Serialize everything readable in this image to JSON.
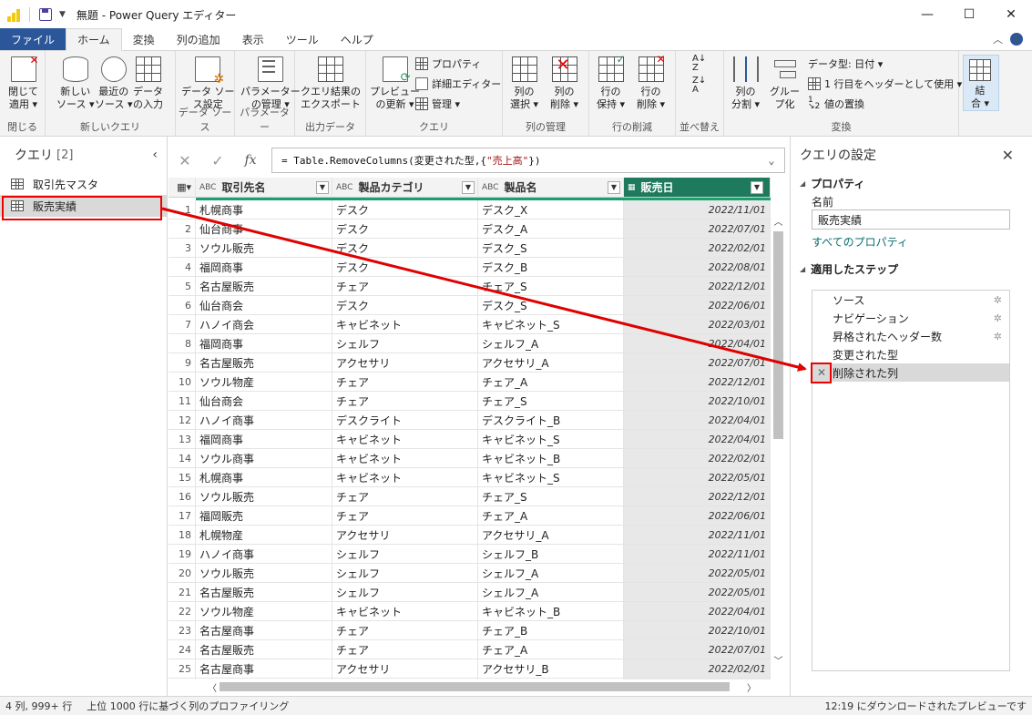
{
  "window": {
    "title": "無題 - Power Query エディター",
    "minimize": "—",
    "maximize": "☐",
    "close": "✕"
  },
  "tabs": [
    {
      "label": "ファイル"
    },
    {
      "label": "ホーム"
    },
    {
      "label": "変換"
    },
    {
      "label": "列の追加"
    },
    {
      "label": "表示"
    },
    {
      "label": "ツール"
    },
    {
      "label": "ヘルプ"
    }
  ],
  "tabs_right": {
    "collapse": "︿",
    "help": "?"
  },
  "ribbon": {
    "close_apply": "閉じて\n適用 ▾",
    "group_close": "閉じる",
    "new_source": "新しい\nソース ▾",
    "recent_source": "最近の\nソース ▾",
    "enter_data": "データ\nの入力",
    "group_new_query": "新しいクエリ",
    "datasource_settings": "データ ソー\nス設定",
    "group_datasource": "データ ソース",
    "manage_params": "パラメーター\nの管理 ▾",
    "group_params": "パラメーター",
    "export_results": "クエリ結果の\nエクスポート",
    "group_output": "出力データ",
    "refresh_preview": "プレビュー\nの更新 ▾",
    "properties": "プロパティ",
    "advanced_editor": "詳細エディター",
    "manage": "管理 ▾",
    "group_query": "クエリ",
    "choose_columns": "列の\n選択 ▾",
    "remove_columns": "列の\n削除 ▾",
    "group_manage_columns": "列の管理",
    "keep_rows": "行の\n保持 ▾",
    "remove_rows": "行の\n削除 ▾",
    "group_reduce_rows": "行の削減",
    "group_sort": "並べ替え",
    "split_column": "列の\n分割 ▾",
    "group_by": "グルー\nプ化",
    "data_type": "データ型: 日付 ▾",
    "first_row_header": "1 行目をヘッダーとして使用 ▾",
    "replace_values": "値の置換",
    "group_transform": "変換",
    "combine": "結\n合 ▾"
  },
  "queries_pane": {
    "title": "クエリ",
    "count": "[2]",
    "collapse": "‹",
    "items": [
      {
        "label": "取引先マスタ"
      },
      {
        "label": "販売実績"
      }
    ]
  },
  "formula": {
    "cancel": "✕",
    "commit": "✓",
    "fx": "fx",
    "prefix": "= Table.RemoveColumns(変更された型,{",
    "string": "\"売上高\"",
    "suffix": "})",
    "expand": "⌄"
  },
  "grid": {
    "columns": [
      {
        "type": "ABC",
        "label": "取引先名"
      },
      {
        "type": "ABC",
        "label": "製品カテゴリ"
      },
      {
        "type": "ABC",
        "label": "製品名"
      },
      {
        "type": "▦",
        "label": "販売日"
      }
    ],
    "rows": [
      [
        "1",
        "札幌商事",
        "デスク",
        "デスク_X",
        "2022/11/01"
      ],
      [
        "2",
        "仙台商事",
        "デスク",
        "デスク_A",
        "2022/07/01"
      ],
      [
        "3",
        "ソウル販売",
        "デスク",
        "デスク_S",
        "2022/02/01"
      ],
      [
        "4",
        "福岡商事",
        "デスク",
        "デスク_B",
        "2022/08/01"
      ],
      [
        "5",
        "名古屋販売",
        "チェア",
        "チェア_S",
        "2022/12/01"
      ],
      [
        "6",
        "仙台商会",
        "デスク",
        "デスク_S",
        "2022/06/01"
      ],
      [
        "7",
        "ハノイ商会",
        "キャビネット",
        "キャビネット_S",
        "2022/03/01"
      ],
      [
        "8",
        "福岡商事",
        "シェルフ",
        "シェルフ_A",
        "2022/04/01"
      ],
      [
        "9",
        "名古屋販売",
        "アクセサリ",
        "アクセサリ_A",
        "2022/07/01"
      ],
      [
        "10",
        "ソウル物産",
        "チェア",
        "チェア_A",
        "2022/12/01"
      ],
      [
        "11",
        "仙台商会",
        "チェア",
        "チェア_S",
        "2022/10/01"
      ],
      [
        "12",
        "ハノイ商事",
        "デスクライト",
        "デスクライト_B",
        "2022/04/01"
      ],
      [
        "13",
        "福岡商事",
        "キャビネット",
        "キャビネット_S",
        "2022/04/01"
      ],
      [
        "14",
        "ソウル商事",
        "キャビネット",
        "キャビネット_B",
        "2022/02/01"
      ],
      [
        "15",
        "札幌商事",
        "キャビネット",
        "キャビネット_S",
        "2022/05/01"
      ],
      [
        "16",
        "ソウル販売",
        "チェア",
        "チェア_S",
        "2022/12/01"
      ],
      [
        "17",
        "福岡販売",
        "チェア",
        "チェア_A",
        "2022/06/01"
      ],
      [
        "18",
        "札幌物産",
        "アクセサリ",
        "アクセサリ_A",
        "2022/11/01"
      ],
      [
        "19",
        "ハノイ商事",
        "シェルフ",
        "シェルフ_B",
        "2022/11/01"
      ],
      [
        "20",
        "ソウル販売",
        "シェルフ",
        "シェルフ_A",
        "2022/05/01"
      ],
      [
        "21",
        "名古屋販売",
        "シェルフ",
        "シェルフ_A",
        "2022/05/01"
      ],
      [
        "22",
        "ソウル物産",
        "キャビネット",
        "キャビネット_B",
        "2022/04/01"
      ],
      [
        "23",
        "名古屋商事",
        "チェア",
        "チェア_B",
        "2022/10/01"
      ],
      [
        "24",
        "名古屋販売",
        "チェア",
        "チェア_A",
        "2022/07/01"
      ],
      [
        "25",
        "名古屋商事",
        "アクセサリ",
        "アクセサリ_B",
        "2022/02/01"
      ],
      [
        "26",
        "",
        "",
        "",
        ""
      ]
    ]
  },
  "settings_pane": {
    "title": "クエリの設定",
    "close": "✕",
    "properties_header": "プロパティ",
    "name_label": "名前",
    "name_value": "販売実績",
    "all_properties": "すべてのプロパティ",
    "steps_header": "適用したステップ",
    "steps": [
      {
        "label": "ソース",
        "gear": "✲"
      },
      {
        "label": "ナビゲーション",
        "gear": "✲"
      },
      {
        "label": "昇格されたヘッダー数",
        "gear": "✲"
      },
      {
        "label": "変更された型",
        "gear": ""
      },
      {
        "label": "削除された列",
        "gear": ""
      }
    ],
    "delete_step": "✕"
  },
  "status": {
    "dims": "4 列, 999+ 行",
    "profiling": "上位 1000 行に基づく列のプロファイリング",
    "download": "12:19 にダウンロードされたプレビューです"
  },
  "colors": {
    "accent": "#2b579a",
    "date_header": "#1e7a5c",
    "annotation_red": "#e00000"
  }
}
